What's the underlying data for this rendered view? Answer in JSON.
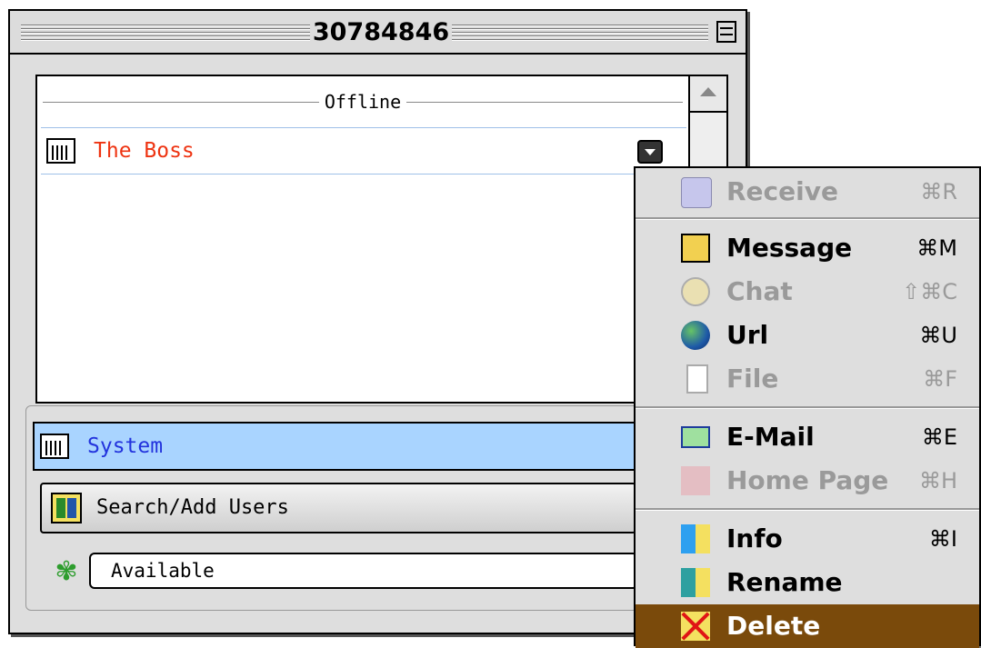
{
  "window": {
    "title": "30784846"
  },
  "contact_list": {
    "group_header": "Offline",
    "contacts": [
      {
        "name": "The Boss",
        "color": "#ee3311",
        "icon": "user-list-icon"
      }
    ]
  },
  "system_row": {
    "label": "System",
    "color": "#2233dd",
    "icon": "user-list-icon"
  },
  "search_button": {
    "label": "Search/Add Users",
    "icon": "search-users-icon"
  },
  "status": {
    "value": "Available",
    "icon": "flower-status-icon",
    "icon_color": "#2e9d2e"
  },
  "popup_menu": {
    "items": [
      {
        "label": "Receive",
        "shortcut": "⌘R",
        "enabled": false,
        "icon": "receive-phone-icon"
      },
      {
        "label": "Message",
        "shortcut": "⌘M",
        "enabled": true,
        "icon": "message-icon"
      },
      {
        "label": "Chat",
        "shortcut": "⇧⌘C",
        "enabled": false,
        "icon": "chat-bubble-icon"
      },
      {
        "label": "Url",
        "shortcut": "⌘U",
        "enabled": true,
        "icon": "globe-icon"
      },
      {
        "label": "File",
        "shortcut": "⌘F",
        "enabled": false,
        "icon": "file-icon"
      },
      {
        "label": "E-Mail",
        "shortcut": "⌘E",
        "enabled": true,
        "icon": "envelope-icon"
      },
      {
        "label": "Home Page",
        "shortcut": "⌘H",
        "enabled": false,
        "icon": "house-icon"
      },
      {
        "label": "Info",
        "shortcut": "⌘I",
        "enabled": true,
        "icon": "info-icon"
      },
      {
        "label": "Rename",
        "shortcut": "",
        "enabled": true,
        "icon": "rename-icon"
      },
      {
        "label": "Delete",
        "shortcut": "",
        "enabled": true,
        "selected": true,
        "icon": "delete-icon"
      }
    ],
    "selected_color": "#7a4a0b"
  }
}
